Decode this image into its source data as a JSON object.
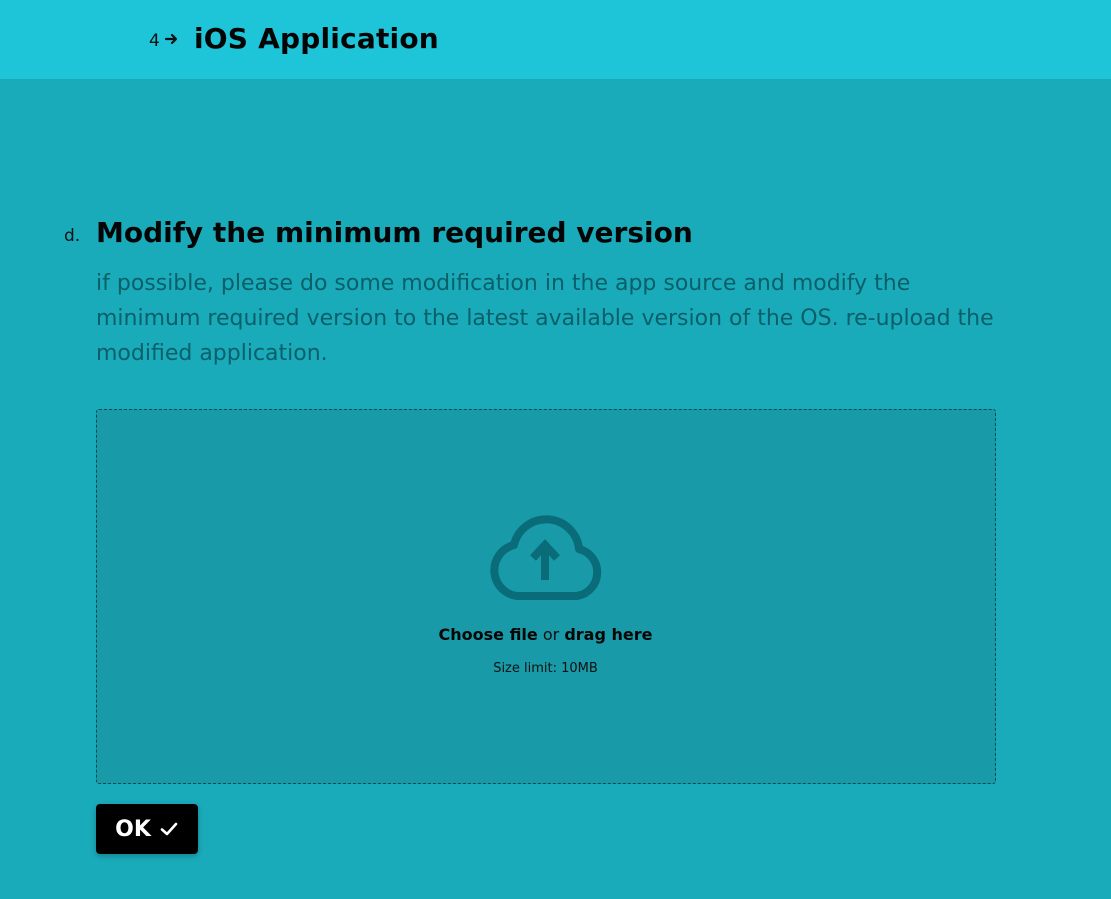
{
  "header": {
    "step_number": "4",
    "arrow_icon": "arrow-right-icon",
    "title": "iOS Application"
  },
  "question": {
    "letter": "d.",
    "title": "Modify the minimum required version",
    "description": "if possible, please do some modification in the app source and modify the minimum required version to the latest available version of the OS. re-upload the modified application."
  },
  "upload": {
    "icon": "cloud-upload-icon",
    "choose_label": "Choose file",
    "or_text": "or",
    "drag_label": "drag here",
    "size_limit": "Size limit: 10MB"
  },
  "ok_button": {
    "label": "OK",
    "icon": "check-icon"
  },
  "colors": {
    "background": "#1aabbb",
    "header_bg": "#1ec4d7",
    "dropzone_bg": "#189aa8",
    "icon": "#0a6c78",
    "button_bg": "#000000"
  }
}
